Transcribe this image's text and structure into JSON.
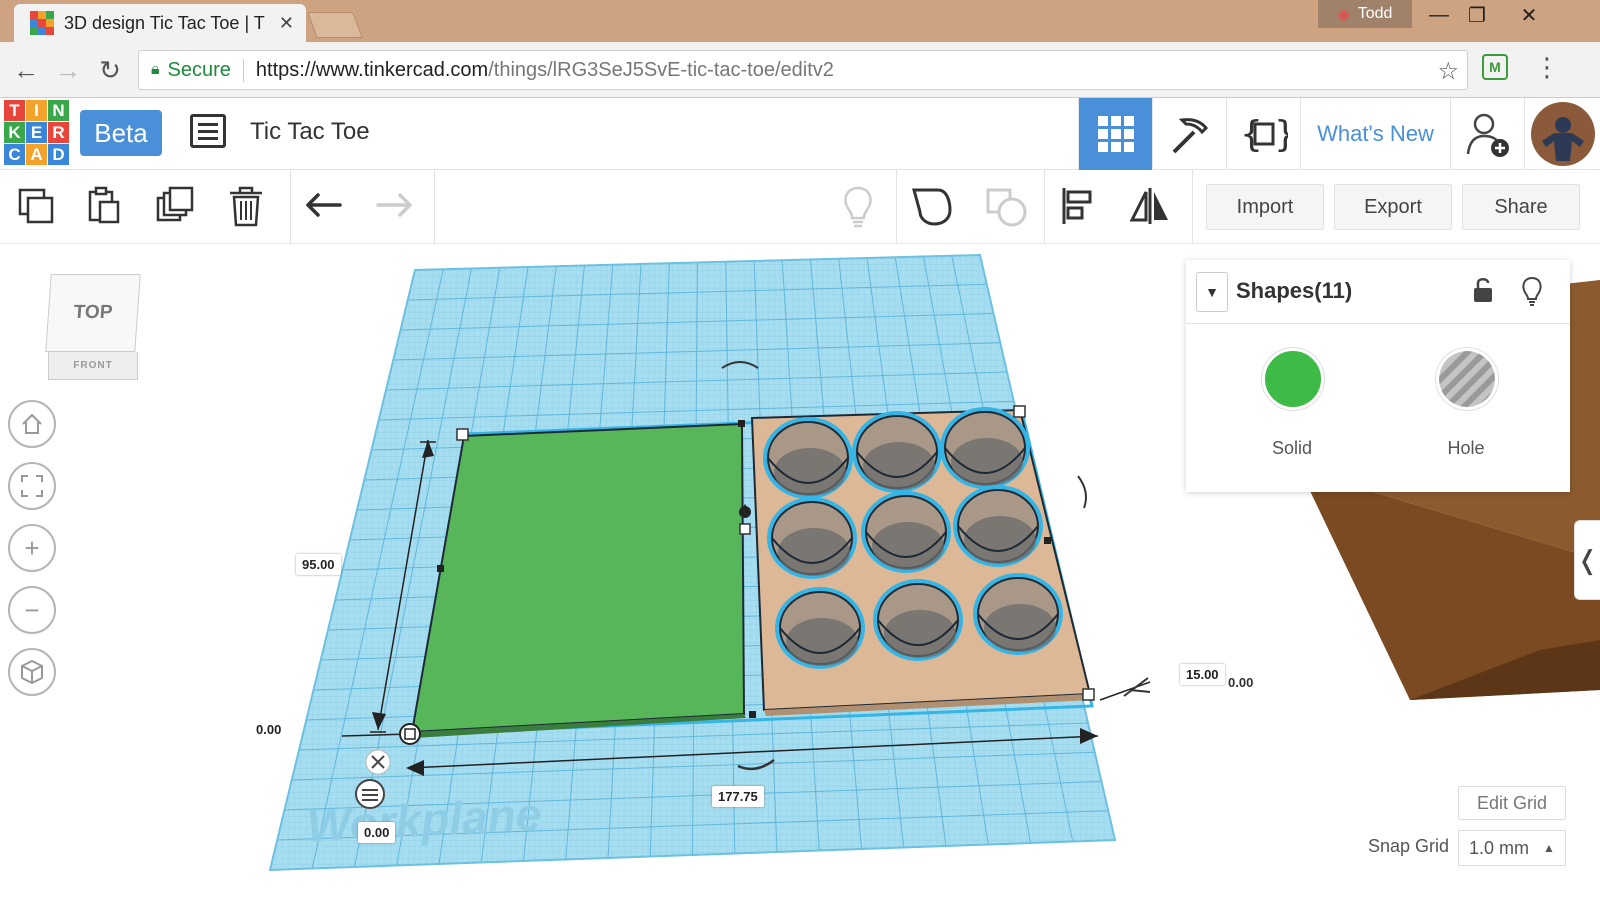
{
  "browser": {
    "tab_title": "3D design Tic Tac Toe | T",
    "user_name": "Todd",
    "secure_label": "Secure",
    "url_host": "https://www.tinkercad.com",
    "url_path": "/things/lRG3SeJ5SvE-tic-tac-toe/editv2"
  },
  "app": {
    "logo_letters": [
      "T",
      "I",
      "N",
      "K",
      "E",
      "R",
      "C",
      "A",
      "D"
    ],
    "beta_label": "Beta",
    "design_title": "Tic Tac Toe",
    "whats_new_label": "What's New"
  },
  "toolbar": {
    "import_label": "Import",
    "export_label": "Export",
    "share_label": "Share"
  },
  "viewcube": {
    "top_label": "TOP",
    "front_label": "FRONT"
  },
  "workplane": {
    "label": "Workplane"
  },
  "dimensions": {
    "height": "95.00",
    "origin_y": "0.00",
    "origin_x": "0.00",
    "width": "177.75",
    "depth": "15.00",
    "elevation": "0.00"
  },
  "shapes_panel": {
    "title": "Shapes(11)",
    "solid_label": "Solid",
    "hole_label": "Hole",
    "solid_color": "#3dbb46"
  },
  "grid": {
    "edit_grid_label": "Edit Grid",
    "snap_grid_label": "Snap Grid",
    "snap_value": "1.0 mm"
  }
}
